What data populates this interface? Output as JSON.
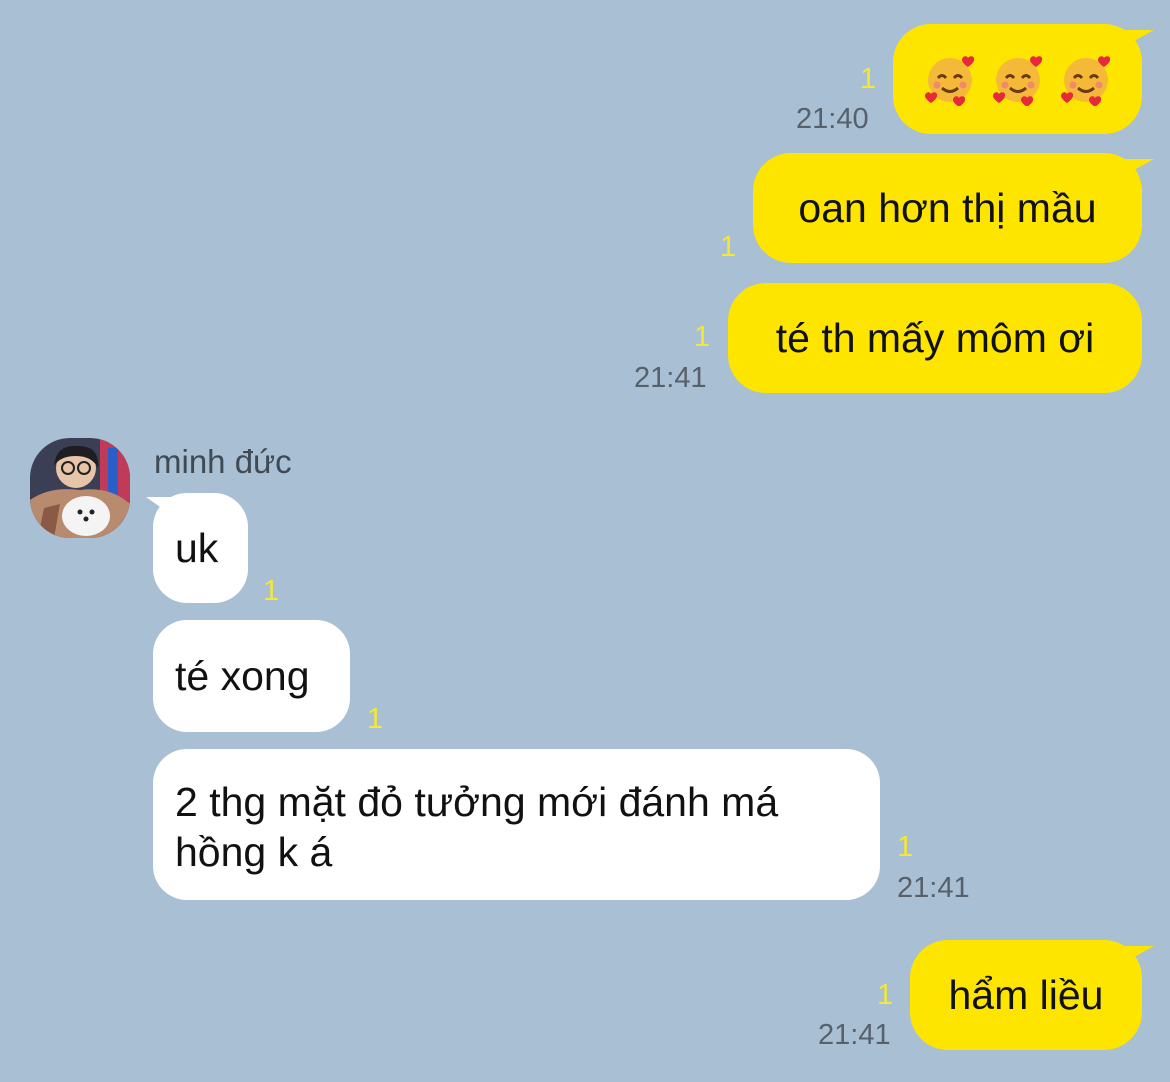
{
  "messages": {
    "m1": {
      "unread": "1",
      "time": "21:40",
      "emoji_names": [
        "smiling-face-with-hearts-icon",
        "smiling-face-with-hearts-icon",
        "smiling-face-with-hearts-icon"
      ]
    },
    "m2": {
      "text": "oan hơn thị mầu",
      "unread": "1"
    },
    "m3": {
      "text": "té th mấy môm ơi",
      "unread": "1",
      "time": "21:41"
    },
    "sender_name": "minh đức",
    "m4": {
      "text": "uk",
      "unread": "1"
    },
    "m5": {
      "text": "té xong",
      "unread": "1"
    },
    "m6": {
      "text": "2 thg mặt đỏ tưởng mới đánh má hồng k á",
      "unread": "1",
      "time": "21:41"
    },
    "m7": {
      "text": "hẩm liều",
      "unread": "1",
      "time": "21:41"
    }
  },
  "colors": {
    "background": "#a9bfd3",
    "outgoing_bubble": "#fee500",
    "incoming_bubble": "#ffffff",
    "unread_count": "#f2e73a",
    "timestamp": "#56616c"
  }
}
